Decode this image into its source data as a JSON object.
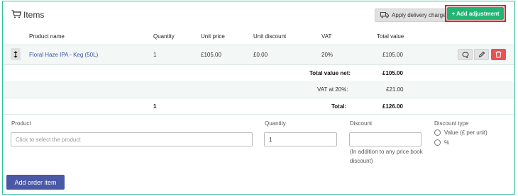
{
  "header": {
    "title": "Items",
    "cart_icon": "cart-icon",
    "delivery_label": "Apply delivery charge",
    "add_adjustment_label": "+ Add adjustment"
  },
  "columns": {
    "product": "Product name",
    "quantity": "Quantity",
    "unit_price": "Unit price",
    "unit_discount": "Unit discount",
    "vat": "VAT",
    "total": "Total value"
  },
  "items": [
    {
      "product": "Floral Haze IPA - Keg (50L)",
      "quantity": "1",
      "unit_price": "£105.00",
      "unit_discount": "£0.00",
      "vat": "20%",
      "total": "£105.00"
    }
  ],
  "summary": {
    "net_label": "Total value net:",
    "net_value": "£105.00",
    "vat_label": "VAT at 20%:",
    "vat_value": "£21.00",
    "total_quantity": "1",
    "total_label": "Total:",
    "total_value": "£126.00"
  },
  "form": {
    "product_label": "Product",
    "product_placeholder": "Click to select the product",
    "quantity_label": "Quantity",
    "quantity_value": "1",
    "discount_label": "Discount",
    "discount_value": "",
    "discount_note_1": "(In addition to any price book",
    "discount_note_2": "discount)",
    "discount_type_label": "Discount type",
    "option_value": "Value (£ per unit)",
    "option_percent": "%"
  },
  "add_order_item_label": "Add order item",
  "colors": {
    "accent_green": "#21b573",
    "frame_border": "#2fbf9b",
    "delete_red": "#e85252",
    "primary_blue": "#4a58a6",
    "link_blue": "#3a56a5",
    "highlight_red": "#dd2222"
  }
}
